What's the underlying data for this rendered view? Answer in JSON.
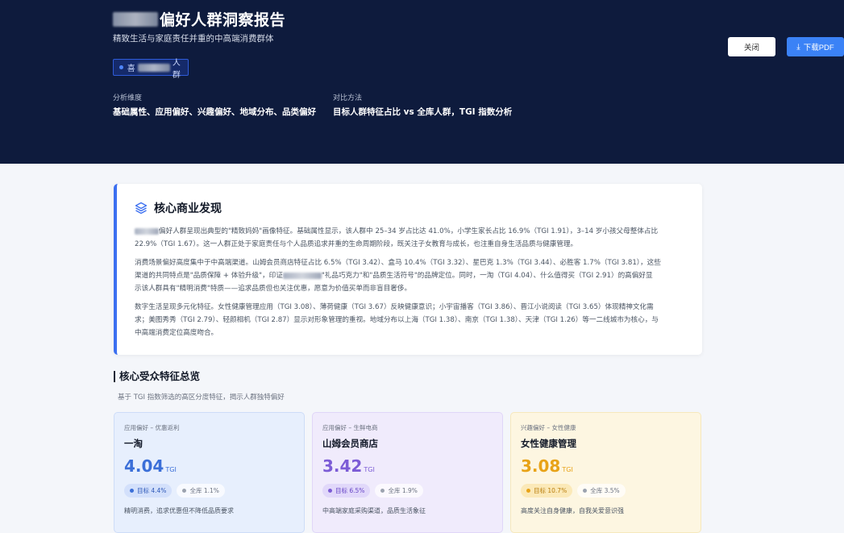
{
  "header": {
    "title_suffix": "偏好人群洞察报告",
    "subtitle": "精致生活与家庭责任并重的中高端消费群体",
    "tag_prefix": "喜",
    "tag_suffix": "人群",
    "dimension_label": "分析维度",
    "dimension_value": "基础属性、应用偏好、兴趣偏好、地域分布、品类偏好",
    "method_label": "对比方法",
    "method_value": "目标人群特征占比 vs 全库人群，TGI 指数分析",
    "close_label": "关闭",
    "pdf_label": "下载PDF"
  },
  "findings": {
    "title": "核心商业发现",
    "p1_a": "偏好人群呈现出典型的\"精致妈妈\"画像特征。基础属性显示，该人群中 25–34 岁占比达 41.0%，小学生家长占比 16.9%（TGI 1.91），3–14 岁小孩父母整体占比",
    "p1_b": "22.9%（TGI 1.67）。这一人群正处于家庭责任与个人品质追求并重的生命周期阶段，既关注子女教育与成长，也注重自身生活品质与健康管理。",
    "p2_a": "消费场景偏好高度集中于中高端渠道。山姆会员商店特征占比 6.5%（TGI 3.42）、盒马 10.4%（TGI 3.32）、星巴克 1.3%（TGI 3.44）、必胜客 1.7%（TGI 3.81），这些",
    "p2_b_pre": "渠道的共同特点是\"品质保障 + 体验升级\"，印证",
    "p2_b_post": "\"礼品巧克力\"和\"品质生活符号\"的品牌定位。同时，一淘（TGI 4.04）、什么值得买（TGI 2.91）的高偏好显",
    "p2_c": "示该人群具有\"精明消费\"特质——追求品质但也关注优惠，愿意为价值买单而非盲目奢侈。",
    "p3_a": "数字生活呈现多元化特征。女性健康管理应用（TGI 3.08）、薄荷健康（TGI 3.67）反映健康意识；小宇宙播客（TGI 3.86）、晋江小说阅读（TGI 3.65）体现精神文化需",
    "p3_b": "求；美图秀秀（TGI 2.79）、轻颜相机（TGI 2.87）显示对形象管理的重视。地域分布以上海（TGI 1.38）、南京（TGI 1.38）、天津（TGI 1.26）等一二线城市为核心，与",
    "p3_c": "中高端消费定位高度吻合。"
  },
  "overview": {
    "title": "核心受众特征总览",
    "subtitle": "基于 TGI 指数筛选的高区分度特征，揭示人群独特偏好",
    "cards": [
      {
        "category": "应用偏好 – 优惠返利",
        "name": "一淘",
        "value": "4.04",
        "tgi": "TGI",
        "target": "目标 4.4%",
        "all": "全库 1.1%",
        "desc": "精明消费，追求优惠但不降低品质要求",
        "accent": "#3b6fd8"
      },
      {
        "category": "应用偏好 – 生鲜电商",
        "name": "山姆会员商店",
        "value": "3.42",
        "tgi": "TGI",
        "target": "目标 6.5%",
        "all": "全库 1.9%",
        "desc": "中高端家庭采购渠道，品质生活象征",
        "accent": "#7c5cd6"
      },
      {
        "category": "兴趣偏好 – 女性健康",
        "name": "女性健康管理",
        "value": "3.08",
        "tgi": "TGI",
        "target": "目标 10.7%",
        "all": "全库 3.5%",
        "desc": "高度关注自身健康，自我关爱意识强",
        "accent": "#e8a317"
      }
    ]
  }
}
